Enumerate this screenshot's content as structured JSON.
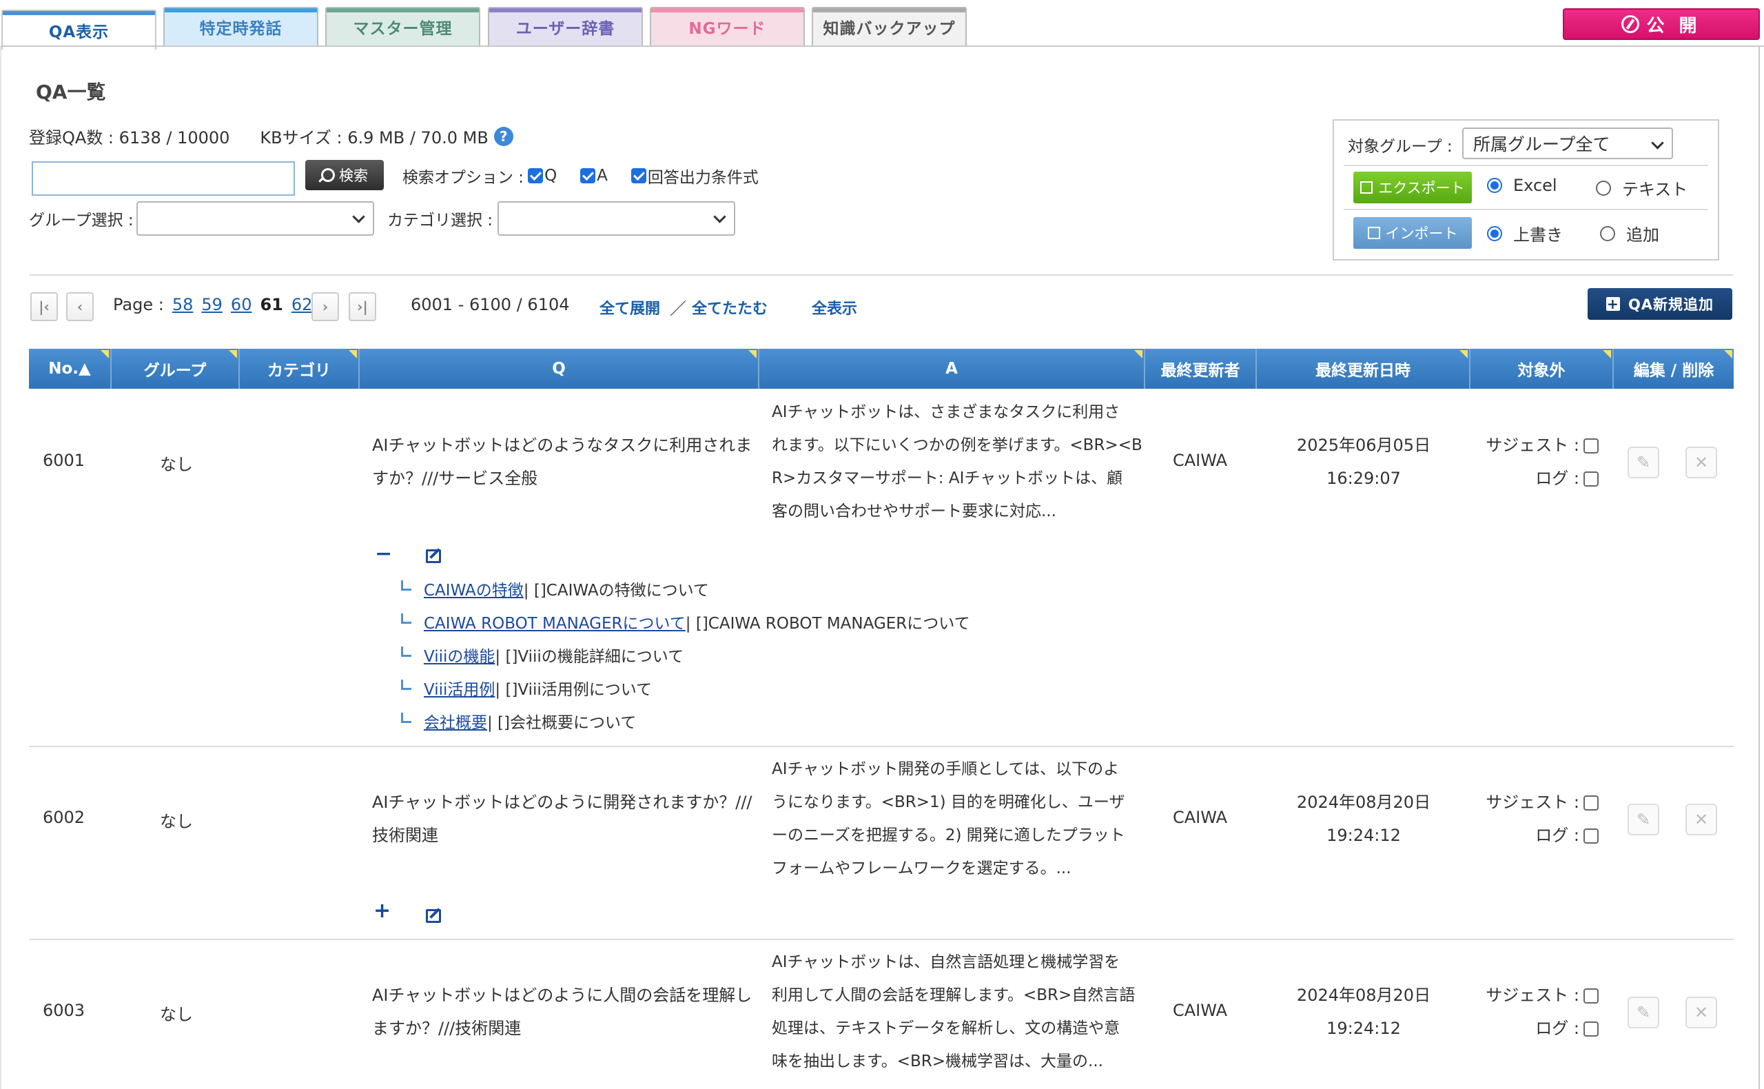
{
  "tabs": [
    {
      "label": "QA表示"
    },
    {
      "label": "特定時発話"
    },
    {
      "label": "マスター管理"
    },
    {
      "label": "ユーザー辞書"
    },
    {
      "label": "NGワード"
    },
    {
      "label": "知識バックアップ"
    }
  ],
  "publish_label": "公 開",
  "page_title": "QA一覧",
  "stats": {
    "qa_count": "登録QA数 : 6138 / 10000",
    "kb_size": "KBサイズ : 6.9 MB / 70.0 MB"
  },
  "search": {
    "value": "",
    "button": "検索",
    "options_label": "検索オプション :",
    "opt_q": "Q",
    "opt_a": "A",
    "opt_cond": "回答出力条件式"
  },
  "filters": {
    "group_label": "グループ選択 :",
    "group_value": "",
    "category_label": "カテゴリ選択 :",
    "category_value": ""
  },
  "panel": {
    "target_label": "対象グループ :",
    "target_value": "所属グループ全て",
    "export_label": "エクスポート",
    "export_opt1": "Excel",
    "export_opt2": "テキスト",
    "import_label": "インポート",
    "import_opt1": "上書き",
    "import_opt2": "追加"
  },
  "pager": {
    "page_label": "Page :",
    "pages": [
      "58",
      "59",
      "60",
      "61",
      "62"
    ],
    "current": "61",
    "range": "6001 - 6100 / 6104",
    "expand_all": "全て展開",
    "slash": "／",
    "collapse_all": "全てたたむ",
    "show_all": "全表示",
    "add_button": "QA新規追加"
  },
  "table": {
    "headers": [
      "No.▲",
      "グループ",
      "カテゴリ",
      "Q",
      "A",
      "最終更新者",
      "最終更新日時",
      "対象外",
      "編集 / 削除"
    ],
    "suggest_label": "サジェスト :",
    "log_label": "ログ :",
    "rows": [
      {
        "no": "6001",
        "group": "なし",
        "category": "",
        "q1": "AIチャットボットはどのようなタスクに利用されま",
        "q2": "すか？///サービス全般",
        "a1": "AIチャットボットは、さまざまなタスクに利用さ",
        "a2": "れます。以下にいくつかの例を挙げます。<BR><B",
        "a3": "R>カスタマーサポート: AIチャットボットは、顧",
        "a4": "客の問い合わせやサポート要求に対応...",
        "updater": "CAIWA",
        "date": "2025年06月05日",
        "time": "16:29:07",
        "toggle": "−",
        "links": [
          {
            "link": "CAIWAの特徴",
            "text": "| []CAIWAの特徴について"
          },
          {
            "link": "CAIWA ROBOT MANAGERについて",
            "text": "| []CAIWA ROBOT MANAGERについて"
          },
          {
            "link": "Viiiの機能",
            "text": "| []Viiiの機能詳細について"
          },
          {
            "link": "Viii活用例",
            "text": "| []Viii活用例について"
          },
          {
            "link": "会社概要",
            "text": "| []会社概要について"
          }
        ]
      },
      {
        "no": "6002",
        "group": "なし",
        "category": "",
        "q1": "AIチャットボットはどのように開発されますか？///",
        "q2": "技術関連",
        "a1": "AIチャットボット開発の手順としては、以下のよ",
        "a2": "うになります。<BR>1) 目的を明確化し、ユーザ",
        "a3": "ーのニーズを把握する。2) 開発に適したプラット",
        "a4": "フォームやフレームワークを選定する。...",
        "updater": "CAIWA",
        "date": "2024年08月20日",
        "time": "19:24:12",
        "toggle": "+"
      },
      {
        "no": "6003",
        "group": "なし",
        "category": "",
        "q1": "AIチャットボットはどのように人間の会話を理解し",
        "q2": "ますか？///技術関連",
        "a1": "AIチャットボットは、自然言語処理と機械学習を",
        "a2": "利用して人間の会話を理解します。<BR>自然言語",
        "a3": "処理は、テキストデータを解析し、文の構造や意",
        "a4": "味を抽出します。<BR>機械学習は、大量の...",
        "updater": "CAIWA",
        "date": "2024年08月20日",
        "time": "19:24:12"
      }
    ]
  },
  "colors": {
    "header_blue": "#2f72b8",
    "publish": "#e0187a",
    "export": "#6cbf20",
    "import": "#6ea4d6",
    "add": "#123867",
    "link": "#1a4a9e"
  }
}
